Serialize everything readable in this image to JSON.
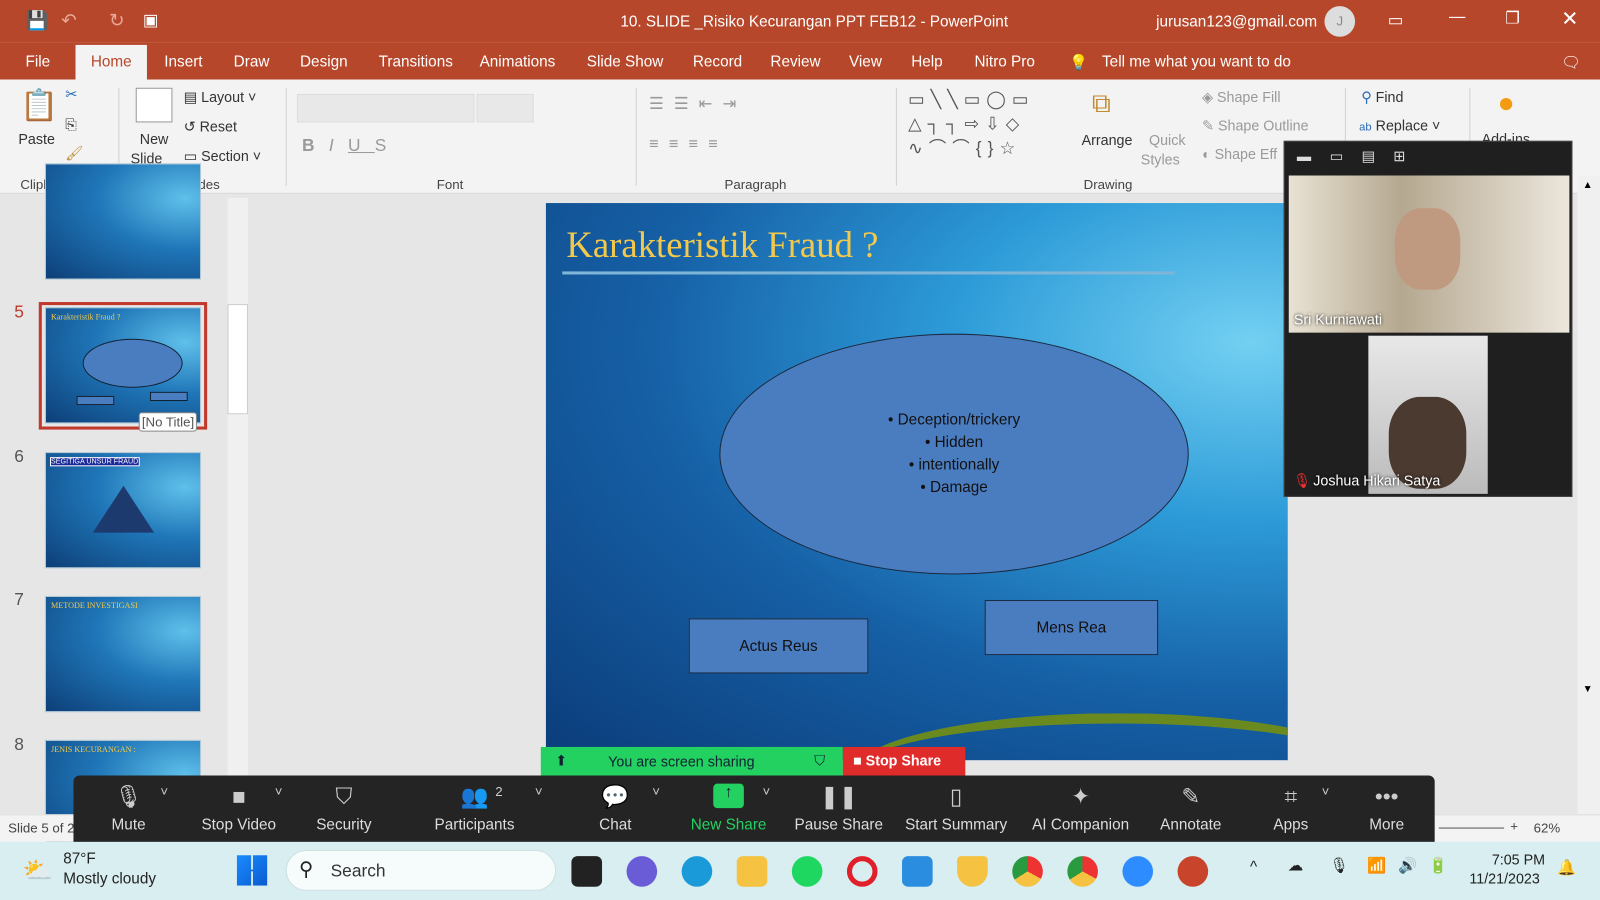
{
  "window": {
    "title": "10. SLIDE _Risiko Kecurangan PPT FEB12  -  PowerPoint",
    "account": "jurusan123@gmail.com",
    "avatar_initial": "J"
  },
  "tabs": [
    "File",
    "Home",
    "Insert",
    "Draw",
    "Design",
    "Transitions",
    "Animations",
    "Slide Show",
    "Record",
    "Review",
    "View",
    "Help",
    "Nitro Pro"
  ],
  "tell_me": "Tell me what you want to do",
  "ribbon": {
    "paste": "Paste",
    "new_slide": "New",
    "new_slide2": "Slide",
    "layout": "Layout",
    "reset": "Reset",
    "section": "Section",
    "groups": [
      "Clipboard",
      "Slides",
      "Font",
      "Paragraph",
      "Drawing"
    ],
    "arrange": "Arrange",
    "quick": "Quick",
    "styles": "Styles",
    "shape_fill": "Shape Fill",
    "shape_outline": "Shape Outline",
    "shape_effects": "Shape Eff",
    "find": "Find",
    "replace": "Replace",
    "addins": "Add-ins"
  },
  "thumbnails": [
    {
      "num": "5",
      "title": "Karakteristik Fraud ?",
      "tooltip": "[No Title]"
    },
    {
      "num": "6",
      "title": "SEGITIGA UNSUR FRAUD"
    },
    {
      "num": "7",
      "title": "METODE INVESTIGASI"
    },
    {
      "num": "8",
      "title": "JENIS KECURANGAN :"
    }
  ],
  "slide": {
    "title": "Karakteristik Fraud ?",
    "bullets": [
      "Deception/trickery",
      "Hidden",
      "intentionally",
      "Damage"
    ],
    "box1": "Actus Reus",
    "box2": "Mens Rea"
  },
  "status": {
    "slide_of": "Slide 5 of 2",
    "zoom": "62%"
  },
  "participants": [
    {
      "name": "Sri Kurniawati"
    },
    {
      "name": "Joshua Hikari Satya",
      "muted": true
    }
  ],
  "sharing": {
    "banner": "You are screen sharing",
    "stop": "Stop Share"
  },
  "toolbar": {
    "items": [
      "Mute",
      "Stop Video",
      "Security",
      "Participants",
      "Chat",
      "New Share",
      "Pause Share",
      "Start Summary",
      "AI Companion",
      "Annotate",
      "Apps",
      "More"
    ],
    "participants_count": "2"
  },
  "taskbar": {
    "temp": "87°F",
    "weather": "Mostly cloudy",
    "search": "Search",
    "time": "7:05 PM",
    "date": "11/21/2023"
  }
}
